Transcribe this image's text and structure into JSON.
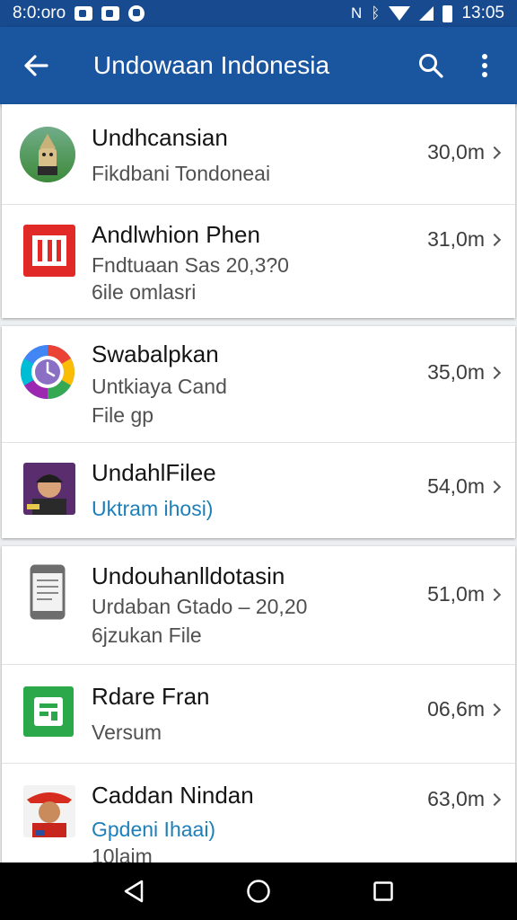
{
  "status_bar": {
    "left_text": "8:0:oro",
    "time": "13:05",
    "icons": [
      "mail-icon",
      "shield-icon",
      "dot-icon",
      "nfc-icon",
      "bluetooth-icon",
      "wifi-icon",
      "signal-icon",
      "battery-icon"
    ]
  },
  "app_bar": {
    "title": "Undowaan Indonesia",
    "icons": [
      "back-arrow-icon",
      "search-icon",
      "more-vert-icon"
    ]
  },
  "cards": [
    {
      "items": [
        {
          "icon": "mascot-icon",
          "title": "Undhcansian",
          "lines": [
            "Fikdbani Tondoneai"
          ],
          "size": "30,0m"
        },
        {
          "icon": "red-app-icon",
          "title": "Andlwhion Phen",
          "lines": [
            "Fndtuaan Sas 20,3?0",
            "6ile omlasri"
          ],
          "size": "31,0m"
        }
      ]
    },
    {
      "items": [
        {
          "icon": "color-wheel-icon",
          "title": "Swabalpkan",
          "lines": [
            "Untkiaya Cand",
            "File gp"
          ],
          "size": "35,0m"
        },
        {
          "icon": "photo-thumbnail-icon",
          "title": "UndahlFilee",
          "lines": [
            "Uktram ihosi)"
          ],
          "size": "54,0m"
        }
      ]
    },
    {
      "items": [
        {
          "icon": "document-icon",
          "title": "Undouhanlldotasin",
          "lines": [
            "Urdaban Gtado – 20,20",
            "6jzukan File"
          ],
          "size": "51,0m"
        },
        {
          "icon": "green-app-icon",
          "title": "Rdare Fran",
          "lines": [
            "Versum"
          ],
          "size": "06,6m"
        },
        {
          "icon": "avatar-icon",
          "title": "Caddan Nindan",
          "lines": [
            "Gpdeni Ihaai)",
            "10laim"
          ],
          "size": "63,0m"
        }
      ]
    }
  ],
  "nav_bar": {
    "icons": [
      "back-triangle-icon",
      "home-circle-icon",
      "recents-square-icon"
    ]
  },
  "colors": {
    "app_bar": "#1a55a0",
    "status_bar": "#174a8f",
    "accent_blue": "#1e7fb8"
  }
}
